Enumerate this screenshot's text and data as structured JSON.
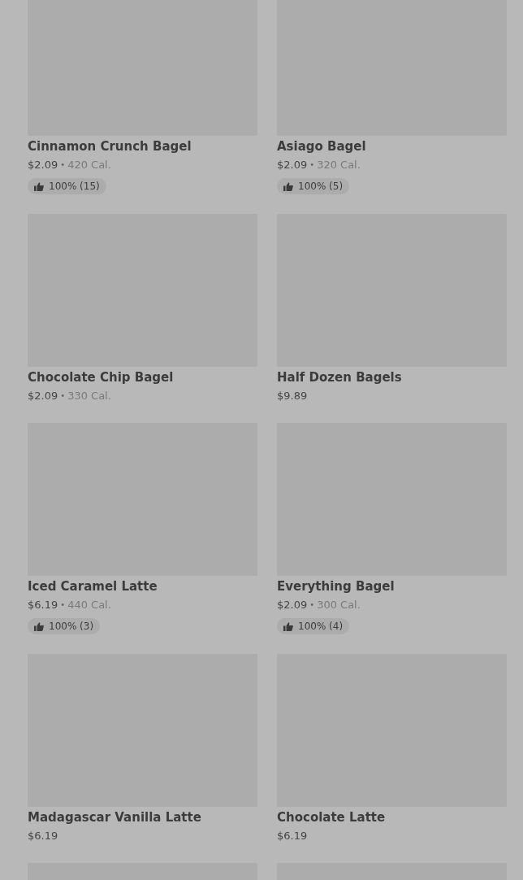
{
  "items": [
    {
      "kind": "product",
      "name": "Cinnamon Crunch Bagel",
      "price": "$2.09",
      "separator": "•",
      "calories": "420 Cal.",
      "rating": "100% (15)"
    },
    {
      "kind": "product",
      "name": "Asiago Bagel",
      "price": "$2.09",
      "separator": "•",
      "calories": "320 Cal.",
      "rating": "100% (5)"
    },
    {
      "kind": "product",
      "name": "Chocolate Chip Bagel",
      "price": "$2.09",
      "separator": "•",
      "calories": "330 Cal."
    },
    {
      "kind": "product",
      "name": "Half Dozen Bagels",
      "price": "$9.89"
    },
    {
      "kind": "product",
      "name": "Iced Caramel Latte",
      "price": "$6.19",
      "separator": "•",
      "calories": "440 Cal.",
      "rating": "100% (3)"
    },
    {
      "kind": "product",
      "name": "Everything Bagel",
      "price": "$2.09",
      "separator": "•",
      "calories": "300 Cal.",
      "rating": "100% (4)"
    },
    {
      "kind": "product",
      "name": "Madagascar Vanilla Latte",
      "price": "$6.19"
    },
    {
      "kind": "product",
      "name": "Chocolate Latte",
      "price": "$6.19"
    },
    {
      "kind": "image-only"
    },
    {
      "kind": "image-only"
    }
  ]
}
